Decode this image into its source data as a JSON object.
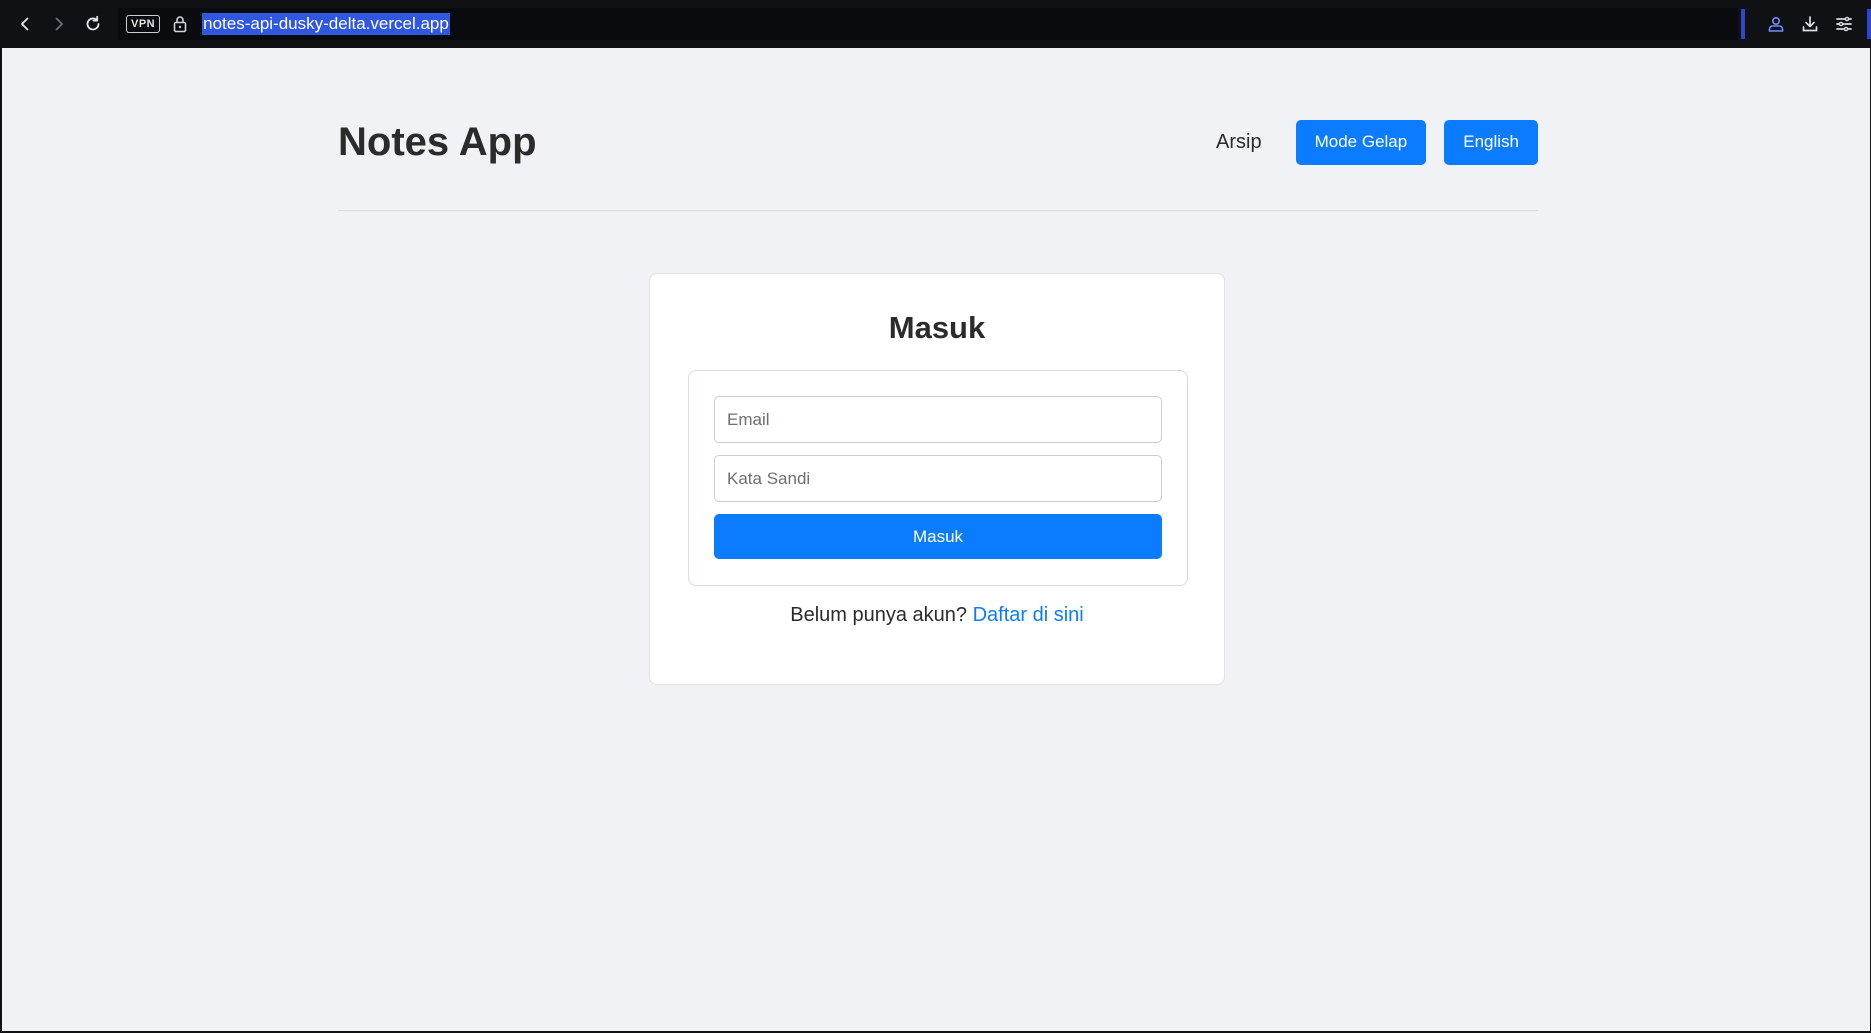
{
  "browser": {
    "url": "notes-api-dusky-delta.vercel.app",
    "vpn_label": "VPN",
    "accent_color": "#3046c8",
    "icons": [
      "back-icon",
      "forward-icon",
      "reload-icon",
      "lock-icon",
      "profile-icon",
      "download-icon",
      "menu-icon"
    ]
  },
  "header": {
    "title": "Notes App",
    "archive_link": "Arsip",
    "theme_button": "Mode Gelap",
    "language_button": "English"
  },
  "login": {
    "title": "Masuk",
    "email_placeholder": "Email",
    "password_placeholder": "Kata Sandi",
    "submit_label": "Masuk",
    "register_prompt": "Belum punya akun?",
    "register_link": "Daftar di sini"
  },
  "colors": {
    "primary": "#0b7cff",
    "background": "#f0f2f5",
    "card": "#ffffff",
    "text": "#2b2b2b"
  }
}
